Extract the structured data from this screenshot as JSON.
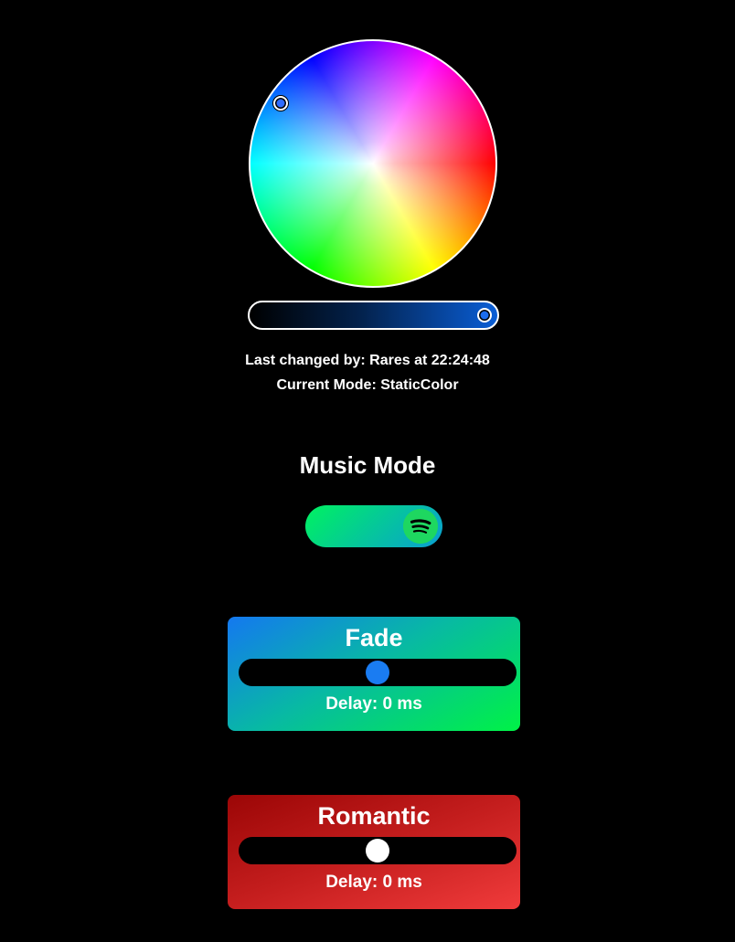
{
  "color_picker": {
    "selected_color": "#2f6cff",
    "brightness_percent": 95
  },
  "status": {
    "last_changed": "Last changed by: Rares at 22:24:48",
    "current_mode": "Current Mode: StaticColor"
  },
  "music_mode": {
    "title": "Music Mode",
    "enabled": true,
    "icon": "spotify-icon"
  },
  "modes": [
    {
      "title": "Fade",
      "delay_label": "Delay: 0 ms",
      "slider_value_percent": 50,
      "thumb_color": "#1a7cf2"
    },
    {
      "title": "Romantic",
      "delay_label": "Delay: 0 ms",
      "slider_value_percent": 50,
      "thumb_color": "#ffffff"
    }
  ]
}
